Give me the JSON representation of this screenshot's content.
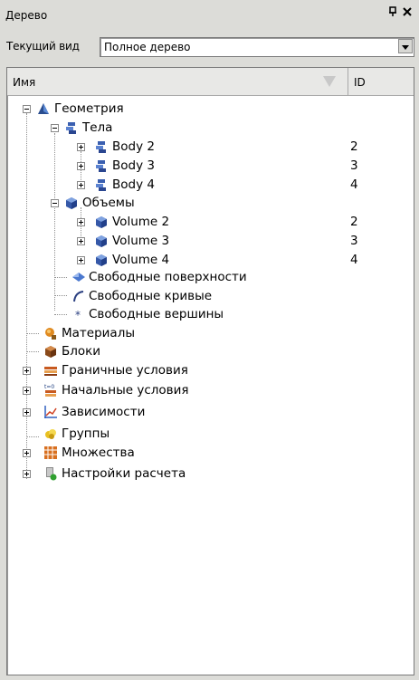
{
  "panel": {
    "title": "Дерево",
    "pin_icon": "pin-icon",
    "close_icon": "close-icon"
  },
  "view": {
    "label": "Текущий вид",
    "selected": "Полное дерево"
  },
  "columns": {
    "name": "Имя",
    "id": "ID"
  },
  "tree": {
    "geometry": "Геометрия",
    "bodies": "Тела",
    "body2": "Body 2",
    "body2_id": "2",
    "body3": "Body 3",
    "body3_id": "3",
    "body4": "Body 4",
    "body4_id": "4",
    "volumes": "Объемы",
    "volume2": "Volume 2",
    "volume2_id": "2",
    "volume3": "Volume 3",
    "volume3_id": "3",
    "volume4": "Volume 4",
    "volume4_id": "4",
    "free_surfaces": "Свободные поверхности",
    "free_curves": "Свободные кривые",
    "free_vertices": "Свободные вершины",
    "materials": "Материалы",
    "blocks": "Блоки",
    "boundary": "Граничные условия",
    "initial": "Начальные условия",
    "dependencies": "Зависимости",
    "groups": "Группы",
    "sets": "Множества",
    "settings": "Настройки расчета"
  }
}
